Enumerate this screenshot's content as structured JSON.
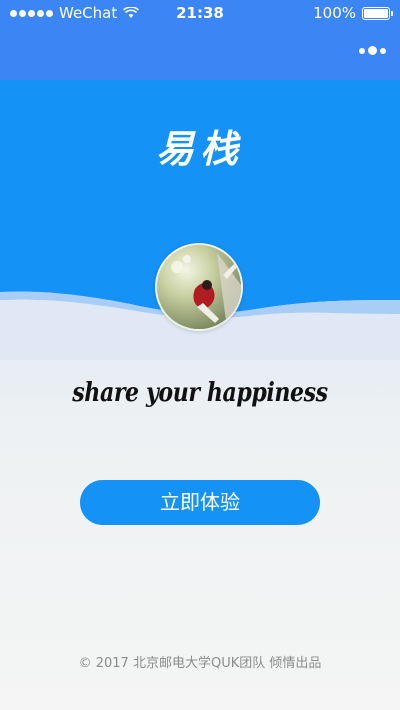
{
  "status_bar": {
    "carrier": "WeChat",
    "time": "21:38",
    "battery": "100%"
  },
  "app": {
    "title": "易栈",
    "tagline": "share your happiness",
    "start_button_label": "立即体验",
    "footer": "© 2017 北京邮电大学QUK团队 倾情出品"
  },
  "colors": {
    "nav_bg": "#3b86f4",
    "hero_bg": "#1592f6",
    "button_bg": "#1592f6",
    "page_bg": "#f4f5f4"
  }
}
